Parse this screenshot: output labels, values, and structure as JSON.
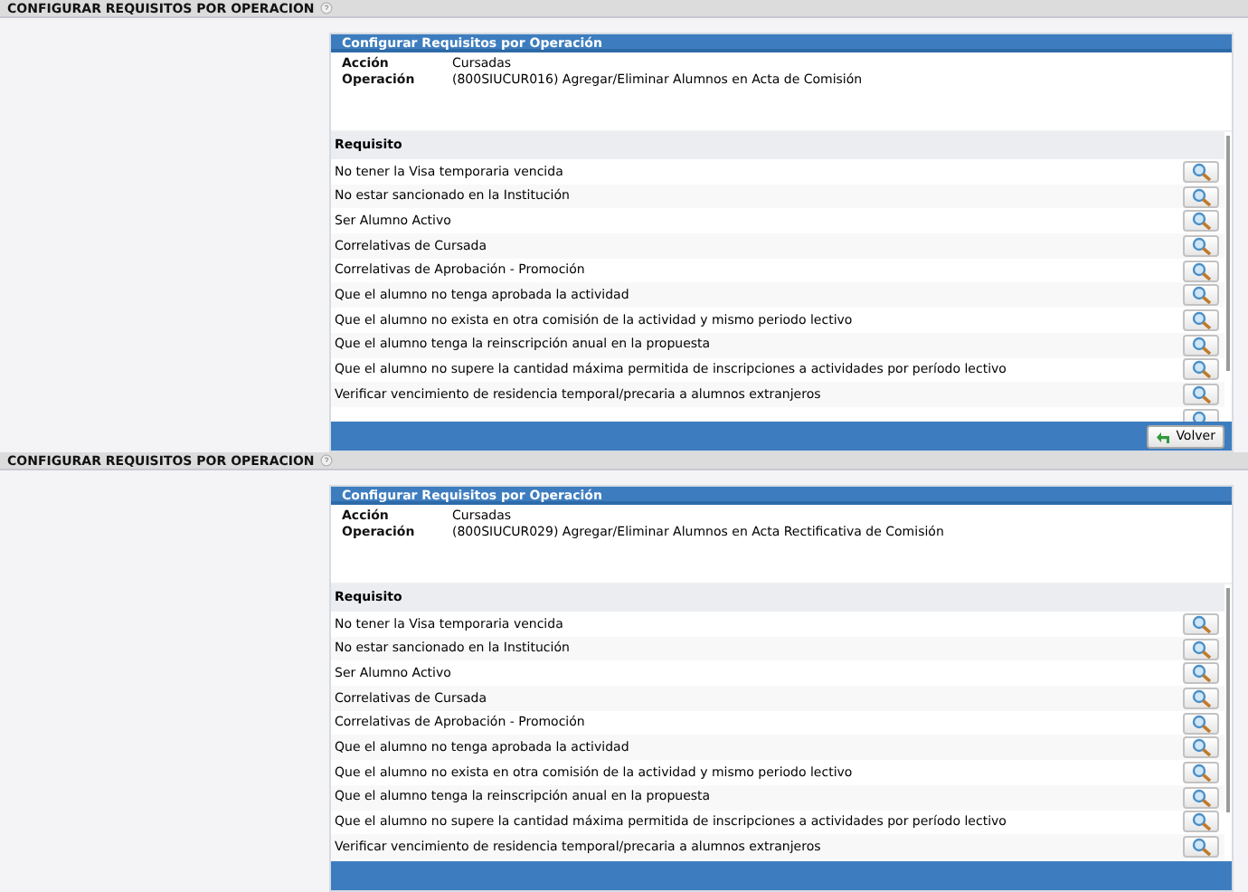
{
  "panels": [
    {
      "title": "CONFIGURAR REQUISITOS POR OPERACION",
      "card": {
        "title": "Configurar Requisitos por Operación",
        "fields": [
          {
            "label": "Acción",
            "value": "Cursadas"
          },
          {
            "label": "Operación",
            "value": "(800SIUCUR016) Agregar/Eliminar Alumnos en Acta de Comisión"
          }
        ],
        "column_header": "Requisito",
        "requirements": [
          "No tener la Visa temporaria vencida",
          "No estar sancionado en la Institución",
          "Ser Alumno Activo",
          "Correlativas de Cursada",
          "Correlativas de Aprobación - Promoción",
          "Que el alumno no tenga aprobada la actividad",
          "Que el alumno no exista en otra comisión de la actividad y mismo periodo lectivo",
          "Que el alumno tenga la reinscripción anual en la propuesta",
          "Que el alumno no supere la cantidad máxima permitida de inscripciones a actividades por período lectivo",
          "Verificar vencimiento de residencia temporal/precaria a alumnos extranjeros"
        ],
        "footer_button": "Volver"
      }
    },
    {
      "title": "CONFIGURAR REQUISITOS POR OPERACION",
      "card": {
        "title": "Configurar Requisitos por Operación",
        "fields": [
          {
            "label": "Acción",
            "value": "Cursadas"
          },
          {
            "label": "Operación",
            "value": "(800SIUCUR029) Agregar/Eliminar Alumnos en Acta Rectificativa de Comisión"
          }
        ],
        "column_header": "Requisito",
        "requirements": [
          "No tener la Visa temporaria vencida",
          "No estar sancionado en la Institución",
          "Ser Alumno Activo",
          "Correlativas de Cursada",
          "Correlativas de Aprobación - Promoción",
          "Que el alumno no tenga aprobada la actividad",
          "Que el alumno no exista en otra comisión de la actividad y mismo periodo lectivo",
          "Que el alumno tenga la reinscripción anual en la propuesta",
          "Que el alumno no supere la cantidad máxima permitida de inscripciones a actividades por período lectivo",
          "Verificar vencimiento de residencia temporal/precaria a alumnos extranjeros"
        ]
      }
    }
  ]
}
